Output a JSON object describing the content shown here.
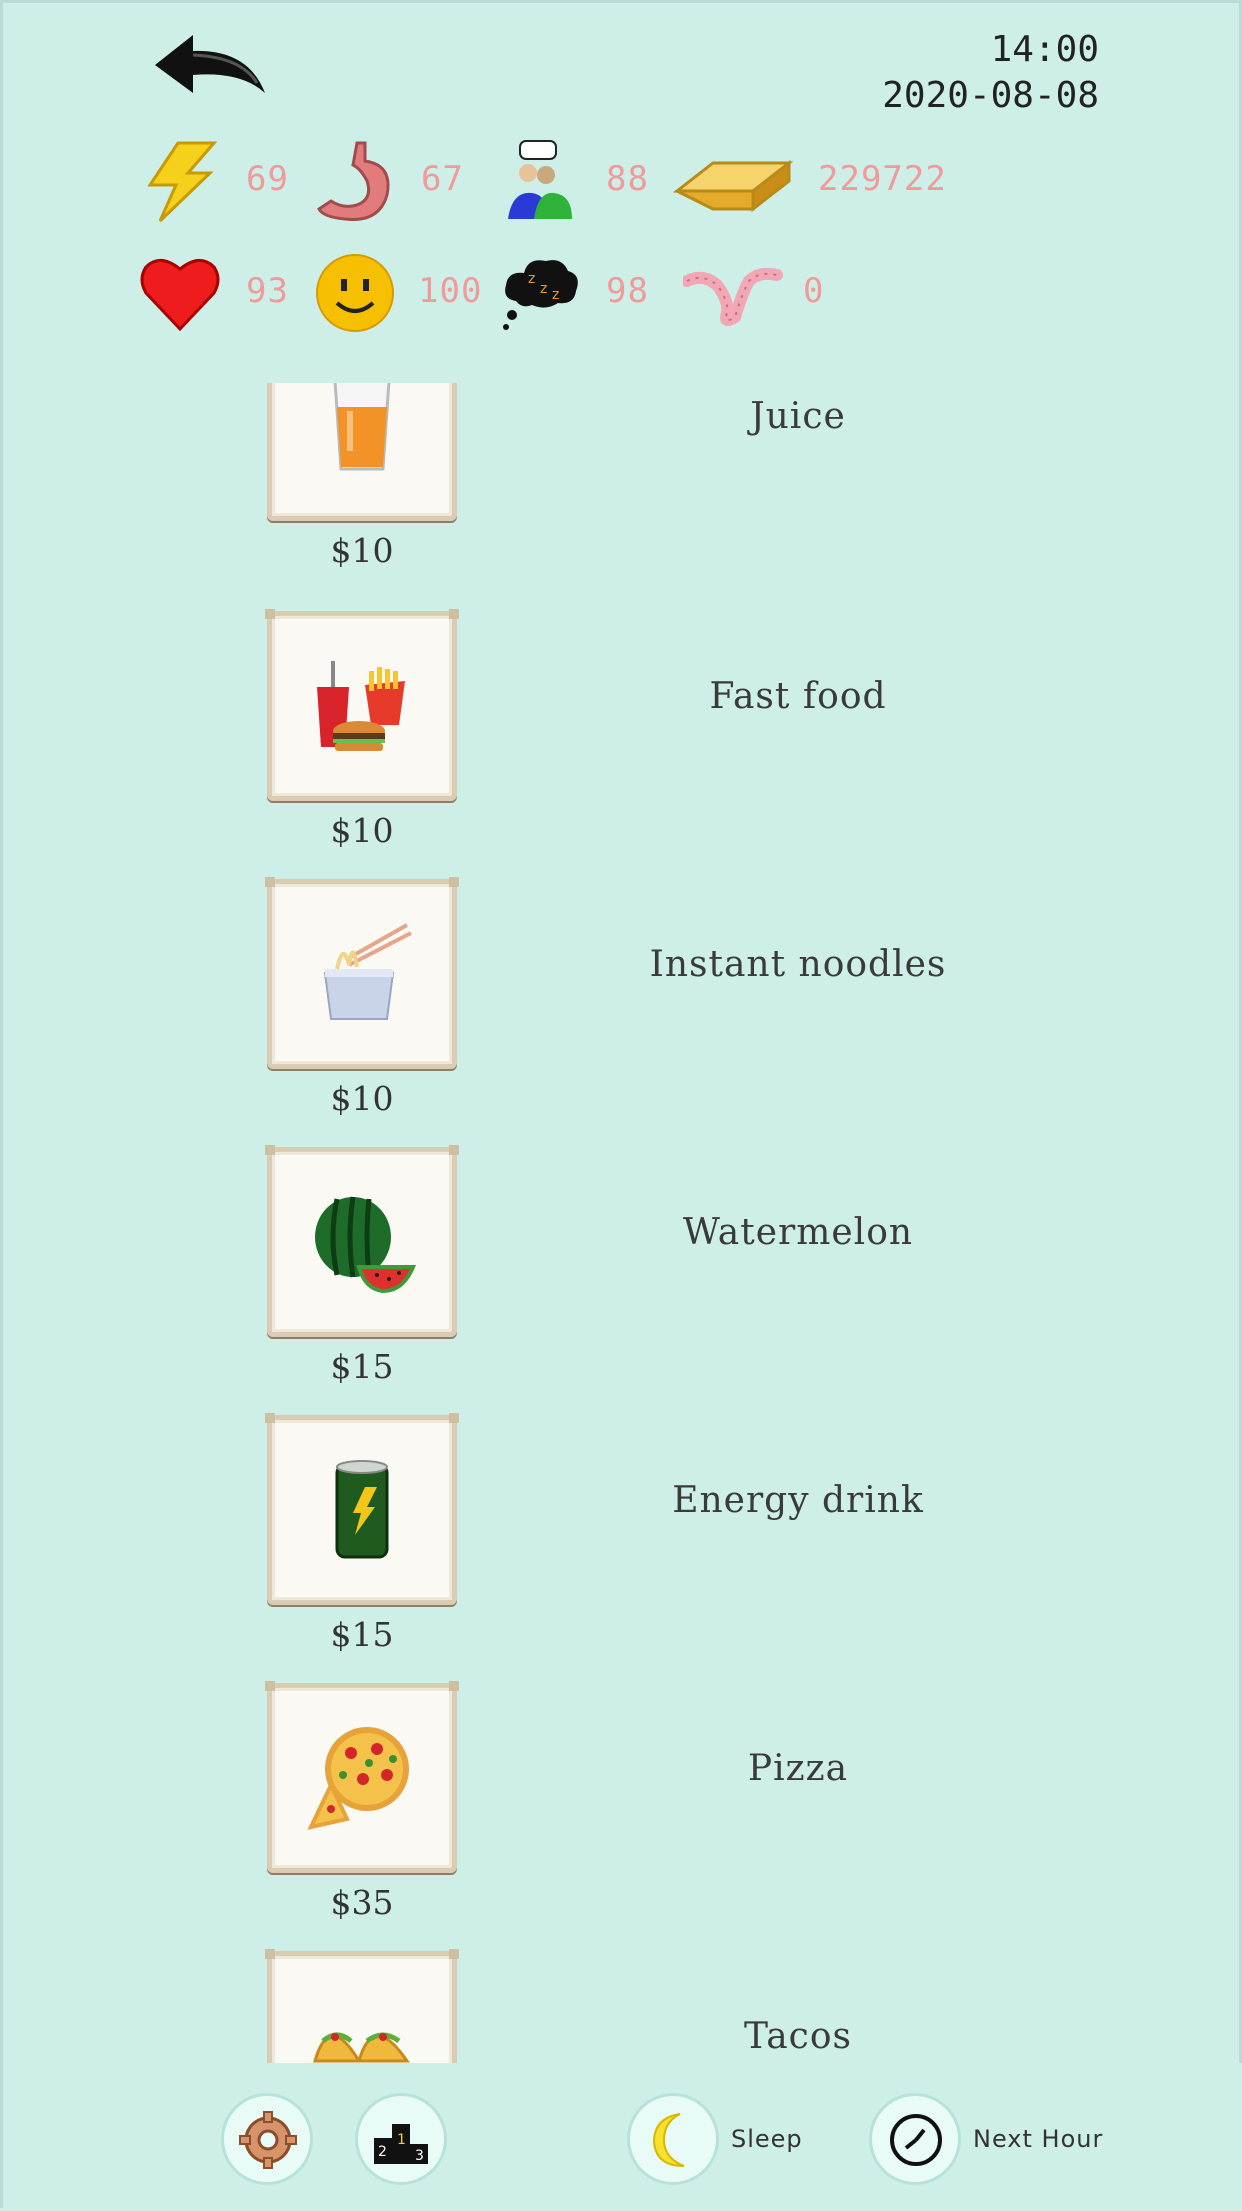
{
  "header": {
    "time": "14:00",
    "date": "2020-08-08"
  },
  "stats": {
    "row1": [
      {
        "icon": "lightning-icon",
        "value": "69"
      },
      {
        "icon": "stomach-icon",
        "value": "67"
      },
      {
        "icon": "social-people-icon",
        "value": "88"
      },
      {
        "icon": "gold-bar-icon",
        "value": "229722"
      }
    ],
    "row2": [
      {
        "icon": "heart-icon",
        "value": "93"
      },
      {
        "icon": "smiley-icon",
        "value": "100"
      },
      {
        "icon": "sleep-cloud-icon",
        "value": "98"
      },
      {
        "icon": "worm-icon",
        "value": "0"
      }
    ]
  },
  "items": [
    {
      "name": "Juice",
      "price": "$10",
      "icon": "juice-icon"
    },
    {
      "name": "Fast food",
      "price": "$10",
      "icon": "fast-food-icon"
    },
    {
      "name": "Instant noodles",
      "price": "$10",
      "icon": "instant-noodles-icon"
    },
    {
      "name": "Watermelon",
      "price": "$15",
      "icon": "watermelon-icon"
    },
    {
      "name": "Energy drink",
      "price": "$15",
      "icon": "energy-drink-icon"
    },
    {
      "name": "Pizza",
      "price": "$35",
      "icon": "pizza-icon"
    },
    {
      "name": "Tacos",
      "price": "",
      "icon": "tacos-icon"
    }
  ],
  "bottom": {
    "sleep_label": "Sleep",
    "next_hour_label": "Next Hour"
  },
  "colors": {
    "background": "#cdefe8",
    "stat_value": "#f19a9a"
  }
}
